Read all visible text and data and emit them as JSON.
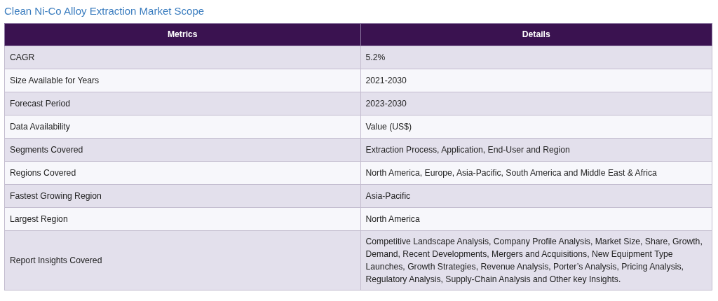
{
  "title": "Clean Ni-Co Alloy Extraction Market Scope",
  "table": {
    "columns": [
      "Metrics",
      "Details"
    ],
    "rows": [
      [
        "CAGR",
        "5.2%"
      ],
      [
        "Size Available for Years",
        "2021-2030"
      ],
      [
        "Forecast Period",
        "2023-2030"
      ],
      [
        "Data Availability",
        "Value (US$)"
      ],
      [
        "Segments Covered",
        "Extraction Process, Application, End-User and Region"
      ],
      [
        "Regions Covered",
        "North America, Europe, Asia-Pacific, South America and Middle East & Africa"
      ],
      [
        "Fastest Growing Region",
        "Asia-Pacific"
      ],
      [
        "Largest Region",
        "North America"
      ],
      [
        "Report Insights Covered",
        "Competitive Landscape Analysis, Company Profile Analysis, Market Size, Share, Growth, Demand, Recent Developments, Mergers and Acquisitions, New Equipment Type Launches, Growth Strategies, Revenue Analysis, Porter’s Analysis, Pricing Analysis, Regulatory Analysis, Supply-Chain Analysis and Other key Insights."
      ]
    ]
  }
}
